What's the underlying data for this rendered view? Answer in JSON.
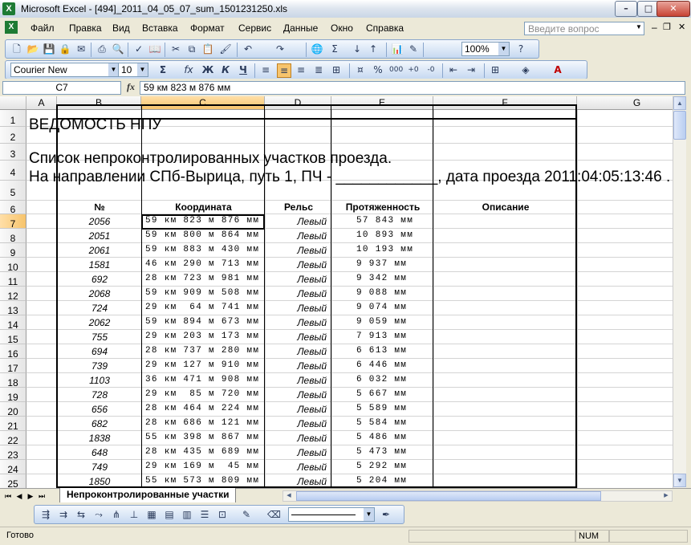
{
  "window": {
    "title": "Microsoft Excel - [494]_2011_04_05_07_sum_1501231250.xls"
  },
  "menu": {
    "items": [
      "Файл",
      "Правка",
      "Вид",
      "Вставка",
      "Формат",
      "Сервис",
      "Данные",
      "Окно",
      "Справка"
    ],
    "help_placeholder": "Введите вопрос"
  },
  "toolbar": {
    "zoom": "100%",
    "font": "Courier New",
    "size": "10",
    "bold": "Ж",
    "italic": "К",
    "underline": "Ч"
  },
  "formula_bar": {
    "name_box": "C7",
    "fx": "fx",
    "content": "59 км 823 м 876 мм"
  },
  "columns": [
    "A",
    "B",
    "C",
    "D",
    "E",
    "F",
    "G"
  ],
  "sheet": {
    "title": "ВЕДОМОСТЬ НПУ",
    "subtitle": "Список непроконтролированных участков проезда.",
    "direction_line": "На направлении СПб-Вырица,  путь 1, ПЧ - ____________, дата проезда 2011:04:05:13:46 .",
    "headers": {
      "num": "№",
      "coord": "Координата",
      "rail": "Рельс",
      "length": "Протяженность",
      "desc": "Описание"
    },
    "rows": [
      {
        "n": "2056",
        "coord": "59 км 823 м 876 мм",
        "rail": "Левый",
        "len": "57 843 мм"
      },
      {
        "n": "2051",
        "coord": "59 км 800 м 864 мм",
        "rail": "Левый",
        "len": "10 893 мм"
      },
      {
        "n": "2061",
        "coord": "59 км 883 м 430 мм",
        "rail": "Левый",
        "len": "10 193 мм"
      },
      {
        "n": "1581",
        "coord": "46 км 290 м 713 мм",
        "rail": "Левый",
        "len": "9 937 мм"
      },
      {
        "n": "692",
        "coord": "28 км 723 м 981 мм",
        "rail": "Левый",
        "len": "9 342 мм"
      },
      {
        "n": "2068",
        "coord": "59 км 909 м 508 мм",
        "rail": "Левый",
        "len": "9 088 мм"
      },
      {
        "n": "724",
        "coord": "29 км  64 м 741 мм",
        "rail": "Левый",
        "len": "9 074 мм"
      },
      {
        "n": "2062",
        "coord": "59 км 894 м 673 мм",
        "rail": "Левый",
        "len": "9 059 мм"
      },
      {
        "n": "755",
        "coord": "29 км 203 м 173 мм",
        "rail": "Левый",
        "len": "7 913 мм"
      },
      {
        "n": "694",
        "coord": "28 км 737 м 280 мм",
        "rail": "Левый",
        "len": "6 613 мм"
      },
      {
        "n": "739",
        "coord": "29 км 127 м 910 мм",
        "rail": "Левый",
        "len": "6 446 мм"
      },
      {
        "n": "1103",
        "coord": "36 км 471 м 908 мм",
        "rail": "Левый",
        "len": "6 032 мм"
      },
      {
        "n": "728",
        "coord": "29 км  85 м 720 мм",
        "rail": "Левый",
        "len": "5 667 мм"
      },
      {
        "n": "656",
        "coord": "28 км 464 м 224 мм",
        "rail": "Левый",
        "len": "5 589 мм"
      },
      {
        "n": "682",
        "coord": "28 км 686 м 121 мм",
        "rail": "Левый",
        "len": "5 584 мм"
      },
      {
        "n": "1838",
        "coord": "55 км 398 м 867 мм",
        "rail": "Левый",
        "len": "5 486 мм"
      },
      {
        "n": "648",
        "coord": "28 км 435 м 689 мм",
        "rail": "Левый",
        "len": "5 473 мм"
      },
      {
        "n": "749",
        "coord": "29 км 169 м  45 мм",
        "rail": "Левый",
        "len": "5 292 мм"
      },
      {
        "n": "1850",
        "coord": "55 км 573 м 809 мм",
        "rail": "Левый",
        "len": "5 204 мм"
      }
    ]
  },
  "row_numbers": [
    "1",
    "2",
    "3",
    "4",
    "5",
    "6",
    "7",
    "8",
    "9",
    "10",
    "11",
    "12",
    "13",
    "14",
    "15",
    "16",
    "17",
    "18",
    "19",
    "20",
    "21",
    "22",
    "23",
    "24",
    "25"
  ],
  "tabs": {
    "active": "Непроконтролированные участки"
  },
  "status": {
    "ready": "Готово",
    "num": "NUM"
  }
}
